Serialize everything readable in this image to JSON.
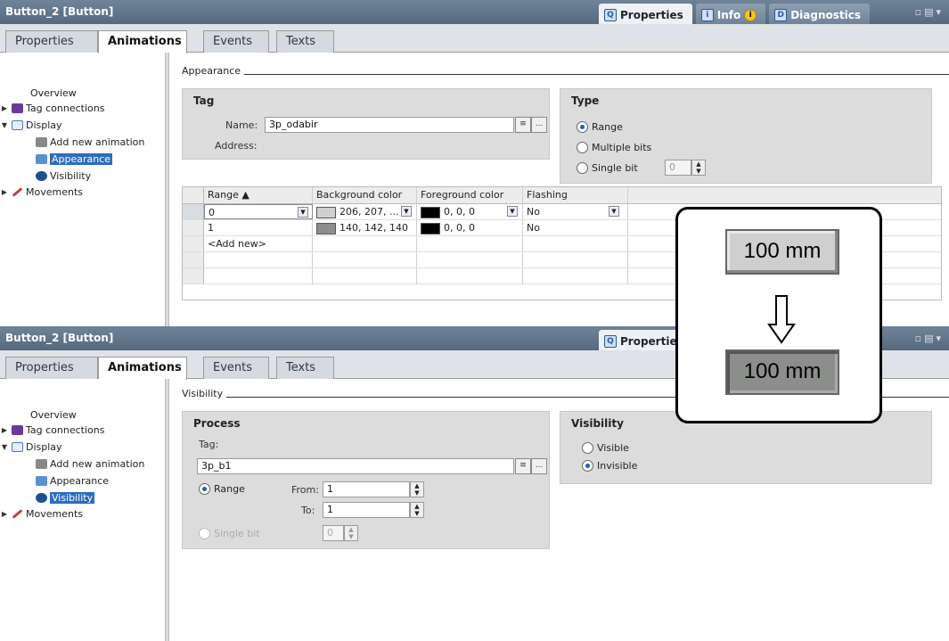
{
  "top_panel": {
    "title": "Button_2 [Button]",
    "right_tabs": [
      {
        "label": "Properties",
        "icon": "magnifier-icon"
      },
      {
        "label": "Info",
        "icon": "info-icon"
      },
      {
        "label": "Diagnostics",
        "icon": "diagnostics-icon"
      }
    ],
    "tabs": [
      "Properties",
      "Animations",
      "Events",
      "Texts"
    ],
    "nav": {
      "overview": "Overview",
      "tag_connections": "Tag connections",
      "display": "Display",
      "add_new": "Add new animation",
      "appearance": "Appearance",
      "visibility": "Visibility",
      "movements": "Movements"
    },
    "section_title": "Appearance",
    "tag_group": {
      "header": "Tag",
      "name_label": "Name:",
      "name_value": "3p_odabir",
      "address_label": "Address:"
    },
    "type_group": {
      "header": "Type",
      "range": "Range",
      "multiple_bits": "Multiple bits",
      "single_bit": "Single bit",
      "single_bit_value": "0"
    },
    "table": {
      "headers": [
        "Range",
        "Background color",
        "Foreground color",
        "Flashing"
      ],
      "rows": [
        {
          "range": "0",
          "bg": "206, 207, ...",
          "bg_color": "#cecfce",
          "fg": "0, 0, 0",
          "fg_color": "#000000",
          "flash": "No"
        },
        {
          "range": "1",
          "bg": "140, 142, 140",
          "bg_color": "#8c8e8c",
          "fg": "0, 0, 0",
          "fg_color": "#000000",
          "flash": "No"
        }
      ],
      "add_new": "<Add new>"
    }
  },
  "bottom_panel": {
    "title": "Button_2 [Button]",
    "right_tab": "Properties",
    "tabs": [
      "Properties",
      "Animations",
      "Events",
      "Texts"
    ],
    "nav": {
      "overview": "Overview",
      "tag_connections": "Tag connections",
      "display": "Display",
      "add_new": "Add new animation",
      "appearance": "Appearance",
      "visibility": "Visibility",
      "movements": "Movements"
    },
    "section_title": "Visibility",
    "process_group": {
      "header": "Process",
      "tag_label": "Tag:",
      "tag_value": "3p_b1",
      "range": "Range",
      "from_label": "From:",
      "from_value": "1",
      "to_label": "To:",
      "to_value": "1",
      "single_bit": "Single bit",
      "single_bit_value": "0"
    },
    "visibility_group": {
      "header": "Visibility",
      "visible": "Visible",
      "invisible": "Invisible"
    }
  },
  "overlay": {
    "button_normal": "100 mm",
    "button_pressed": "100 mm"
  }
}
